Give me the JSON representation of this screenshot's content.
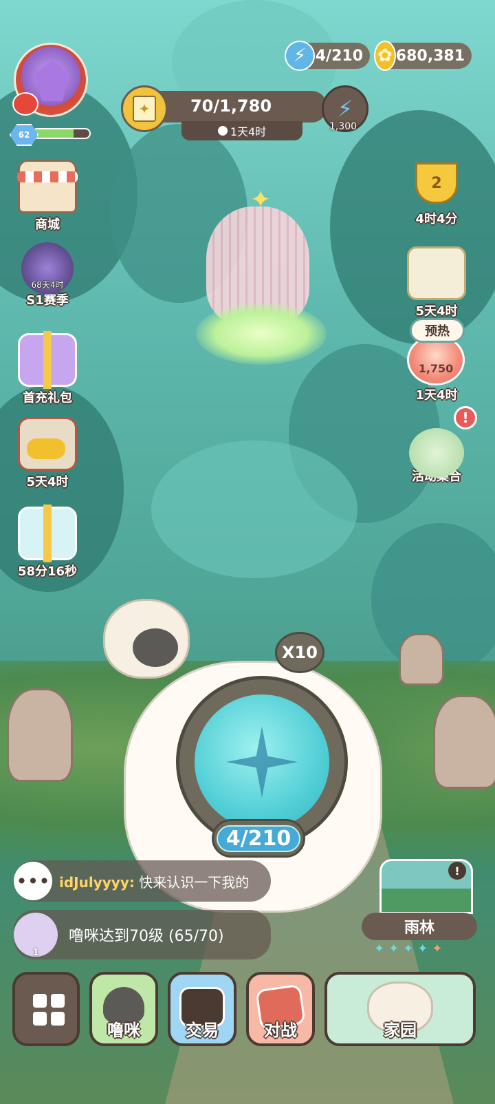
{
  "resources": {
    "energy": {
      "icon": "lightning-icon",
      "value": "4/210"
    },
    "coins": {
      "icon": "coin-icon",
      "value": "680,381"
    }
  },
  "player": {
    "level": "62",
    "level_progress": 0.72
  },
  "event_progress": {
    "value": "70/1,780",
    "timer": "1天4时",
    "bolt_count": "1,300"
  },
  "left_menu": [
    {
      "id": "shop",
      "label": "商城"
    },
    {
      "id": "season",
      "label": "S1赛季",
      "overlay": "68天4时"
    },
    {
      "id": "first_recharge",
      "label": "首充礼包"
    },
    {
      "id": "chest",
      "label": "5天4时"
    },
    {
      "id": "gift_timer",
      "label": "58分16秒"
    }
  ],
  "right_menu": {
    "trophy": {
      "number": "2",
      "label": "4时4分"
    },
    "cat_scroll": {
      "label": "5天4时"
    },
    "warmup": {
      "badge": "预热",
      "count": "1,750",
      "label": "1天4时"
    },
    "alert": "!",
    "events": {
      "label": "活动集合"
    }
  },
  "scanner": {
    "multiplier": "X10",
    "counter": "4/210"
  },
  "chat": {
    "user": "idJulyyyy:",
    "message": "快来认识一下我的",
    "quest_text": "噜咪达到70级 (65/70)",
    "quest_count": "1"
  },
  "location": {
    "name": "雨林",
    "stars_filled": 4,
    "stars_total": 5
  },
  "bottom_nav": {
    "pets": "噜咪",
    "trade": "交易",
    "battle": "对战",
    "home": "家园"
  },
  "colors": {
    "panel_brown": "#6b5a50",
    "energy_blue": "#62b6e6",
    "coin_gold": "#f2c02c",
    "alert_red": "#ea5a58"
  }
}
